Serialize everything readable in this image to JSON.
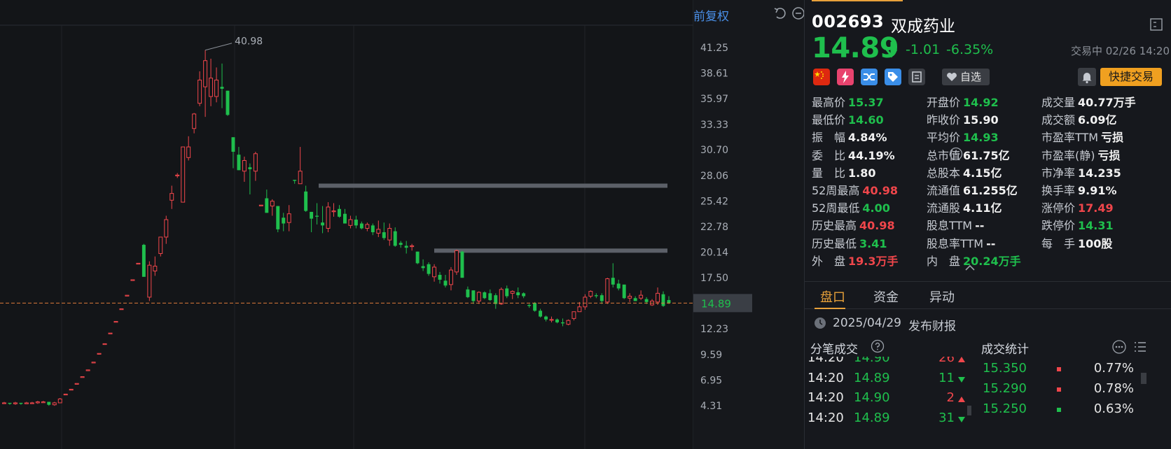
{
  "chart": {
    "adjust_label": "前复权",
    "tools": [
      "undo-icon",
      "zoom-out-icon",
      "zoom-in-icon"
    ],
    "y_ticks": [
      "41.25",
      "38.61",
      "35.97",
      "33.33",
      "30.70",
      "28.06",
      "25.42",
      "22.78",
      "20.14",
      "17.50",
      "14.89",
      "12.23",
      "9.59",
      "6.95",
      "4.31"
    ],
    "peak_label": "40.98",
    "current_price_tag": "14.89",
    "colors": {
      "up": "#f0464b",
      "down": "#1fbf4d",
      "current_line": "#e07b3a",
      "resistance": "#5c6068"
    }
  },
  "chart_data": {
    "type": "candlestick",
    "title": "",
    "y_range": [
      4.31,
      41.25
    ],
    "y_ticks": [
      41.25,
      38.61,
      35.97,
      33.33,
      30.7,
      28.06,
      25.42,
      22.78,
      20.14,
      17.5,
      14.89,
      12.23,
      9.59,
      6.95,
      4.31
    ],
    "peak": 40.98,
    "current": 14.89,
    "resistance_levels": [
      27.0,
      20.3
    ],
    "candles": [
      [
        4.6,
        4.7,
        4.5,
        4.6
      ],
      [
        4.6,
        4.6,
        4.4,
        4.5
      ],
      [
        4.5,
        4.7,
        4.4,
        4.6
      ],
      [
        4.6,
        4.6,
        4.4,
        4.5
      ],
      [
        4.5,
        4.7,
        4.5,
        4.6
      ],
      [
        4.6,
        4.7,
        4.5,
        4.6
      ],
      [
        4.6,
        4.8,
        4.5,
        4.7
      ],
      [
        4.7,
        4.8,
        4.6,
        4.7
      ],
      [
        4.7,
        4.7,
        4.3,
        4.4
      ],
      [
        4.4,
        4.7,
        4.3,
        4.6
      ],
      [
        4.6,
        5.1,
        4.6,
        5.0
      ],
      [
        5.5,
        5.5,
        5.5,
        5.5
      ],
      [
        6.0,
        6.0,
        6.0,
        6.0
      ],
      [
        6.6,
        6.6,
        6.6,
        6.6
      ],
      [
        7.3,
        7.3,
        7.3,
        7.3
      ],
      [
        8.0,
        8.0,
        8.0,
        8.0
      ],
      [
        8.8,
        8.8,
        8.8,
        8.8
      ],
      [
        9.7,
        9.7,
        9.7,
        9.7
      ],
      [
        10.7,
        10.7,
        10.7,
        10.7
      ],
      [
        11.8,
        11.8,
        11.8,
        11.8
      ],
      [
        13.0,
        13.0,
        13.0,
        13.0
      ],
      [
        14.3,
        14.3,
        14.3,
        14.3
      ],
      [
        15.7,
        15.7,
        15.7,
        15.7
      ],
      [
        17.3,
        17.3,
        17.3,
        17.3
      ],
      [
        19.0,
        19.0,
        19.0,
        19.0
      ],
      [
        20.9,
        21.0,
        17.6,
        17.6
      ],
      [
        15.5,
        19.2,
        15.1,
        18.8
      ],
      [
        18.2,
        19.7,
        17.7,
        18.7
      ],
      [
        20.0,
        21.7,
        19.7,
        21.7
      ],
      [
        21.7,
        23.9,
        21.0,
        23.5
      ],
      [
        25.5,
        27.0,
        24.6,
        26.2
      ],
      [
        28.1,
        28.3,
        27.8,
        28.1
      ],
      [
        25.3,
        31.0,
        25.3,
        31.0
      ],
      [
        29.9,
        32.1,
        29.6,
        31.0
      ],
      [
        32.9,
        34.5,
        32.4,
        34.4
      ],
      [
        35.5,
        38.8,
        35.2,
        37.9
      ],
      [
        37.2,
        40.98,
        34.1,
        39.9
      ],
      [
        36.2,
        40.1,
        35.2,
        38.1
      ],
      [
        36.2,
        39.2,
        35.6,
        37.9
      ],
      [
        37.2,
        39.6,
        35.0,
        37.0
      ],
      [
        36.8,
        36.8,
        34.2,
        34.3
      ],
      [
        32.0,
        32.0,
        28.8,
        30.5
      ],
      [
        30.2,
        31.0,
        28.6,
        28.6
      ],
      [
        28.5,
        30.0,
        27.4,
        29.6
      ],
      [
        28.9,
        29.3,
        26.1,
        28.7
      ],
      [
        28.5,
        30.5,
        27.5,
        30.3
      ],
      [
        25.0,
        25.0,
        25.0,
        25.0
      ],
      [
        25.7,
        26.6,
        24.2,
        24.2
      ],
      [
        24.9,
        25.6,
        23.9,
        25.4
      ],
      [
        24.9,
        24.9,
        22.2,
        22.5
      ],
      [
        23.7,
        24.2,
        22.3,
        23.1
      ],
      [
        23.2,
        25.0,
        22.3,
        24.1
      ],
      [
        27.6,
        27.6,
        27.2,
        27.5
      ],
      [
        27.2,
        31.0,
        27.2,
        28.5
      ],
      [
        26.4,
        27.0,
        24.3,
        24.4
      ],
      [
        24.3,
        24.3,
        22.2,
        23.6
      ],
      [
        23.9,
        25.2,
        23.0,
        23.8
      ],
      [
        23.2,
        24.9,
        22.1,
        22.9
      ],
      [
        22.6,
        25.3,
        22.2,
        24.8
      ],
      [
        24.4,
        25.2,
        23.8,
        24.4
      ],
      [
        24.6,
        25.0,
        23.7,
        23.8
      ],
      [
        24.1,
        24.6,
        23.1,
        23.1
      ],
      [
        22.9,
        23.9,
        22.6,
        23.5
      ],
      [
        23.5,
        23.9,
        22.6,
        22.9
      ],
      [
        23.1,
        23.3,
        22.5,
        22.6
      ],
      [
        22.6,
        23.2,
        22.3,
        23.0
      ],
      [
        22.9,
        23.1,
        21.9,
        22.2
      ],
      [
        22.1,
        23.4,
        21.7,
        22.5
      ],
      [
        22.2,
        23.2,
        21.4,
        21.6
      ],
      [
        21.4,
        23.1,
        20.8,
        22.6
      ],
      [
        22.3,
        22.7,
        20.7,
        20.8
      ],
      [
        21.1,
        21.3,
        20.6,
        20.9
      ],
      [
        20.8,
        21.3,
        20.0,
        20.6
      ],
      [
        20.8,
        21.0,
        20.3,
        20.8
      ],
      [
        20.2,
        20.2,
        18.9,
        19.0
      ],
      [
        18.7,
        19.4,
        18.2,
        18.5
      ],
      [
        18.9,
        19.1,
        17.7,
        17.9
      ],
      [
        17.6,
        18.9,
        17.1,
        18.6
      ],
      [
        17.8,
        18.1,
        16.9,
        17.3
      ],
      [
        17.2,
        17.8,
        16.5,
        16.7
      ],
      [
        16.8,
        18.6,
        16.2,
        18.3
      ],
      [
        18.1,
        20.4,
        17.8,
        20.3
      ],
      [
        20.2,
        20.3,
        17.5,
        17.5
      ],
      [
        16.3,
        16.6,
        15.4,
        15.5
      ],
      [
        16.2,
        16.2,
        14.8,
        15.1
      ],
      [
        15.1,
        16.1,
        14.8,
        16.0
      ],
      [
        16.0,
        16.1,
        15.3,
        15.4
      ],
      [
        15.9,
        16.3,
        15.1,
        15.2
      ],
      [
        15.7,
        15.9,
        14.3,
        14.8
      ],
      [
        14.8,
        16.5,
        14.7,
        16.3
      ],
      [
        16.4,
        16.7,
        15.4,
        15.6
      ],
      [
        15.9,
        16.2,
        15.3,
        16.1
      ],
      [
        16.0,
        16.5,
        15.4,
        15.7
      ],
      [
        15.9,
        16.0,
        15.4,
        15.6
      ],
      [
        14.7,
        14.8,
        14.4,
        14.6
      ],
      [
        14.9,
        15.0,
        14.0,
        14.1
      ],
      [
        14.1,
        14.3,
        13.4,
        13.5
      ],
      [
        13.5,
        13.6,
        13.0,
        13.2
      ],
      [
        13.2,
        13.5,
        12.9,
        13.2
      ],
      [
        13.2,
        13.3,
        12.8,
        12.9
      ],
      [
        12.9,
        13.3,
        12.5,
        12.8
      ],
      [
        12.7,
        13.2,
        12.6,
        13.1
      ],
      [
        13.3,
        14.0,
        13.1,
        14.0
      ],
      [
        14.0,
        15.0,
        14.0,
        14.5
      ],
      [
        14.5,
        15.8,
        14.2,
        15.5
      ],
      [
        15.6,
        16.2,
        15.4,
        16.1
      ],
      [
        15.7,
        15.9,
        15.4,
        15.6
      ],
      [
        15.7,
        15.9,
        14.8,
        15.1
      ],
      [
        15.0,
        17.5,
        14.8,
        17.4
      ],
      [
        17.5,
        19.0,
        16.5,
        16.8
      ],
      [
        16.9,
        17.3,
        16.2,
        16.4
      ],
      [
        16.8,
        16.8,
        15.3,
        15.4
      ],
      [
        15.4,
        15.9,
        15.0,
        15.6
      ],
      [
        15.4,
        15.6,
        15.1,
        15.1
      ],
      [
        15.4,
        16.2,
        15.2,
        15.7
      ],
      [
        15.3,
        15.5,
        14.8,
        15.0
      ],
      [
        14.7,
        15.3,
        14.6,
        15.1
      ],
      [
        15.0,
        16.5,
        14.7,
        15.9
      ],
      [
        15.8,
        16.1,
        14.5,
        14.6
      ],
      [
        15.2,
        15.6,
        14.8,
        14.9
      ]
    ]
  },
  "quote": {
    "code": "002693",
    "name": "双成药业",
    "price": "14.89",
    "change": "-1.01",
    "change_pct": "-6.35%",
    "status": "交易中 02/26 14:20",
    "watch_label": "自选",
    "quick_trade_label": "快捷交易",
    "badges": [
      "china-flag-icon",
      "lightning-icon",
      "shuffle-icon",
      "tag-icon",
      "note-icon"
    ]
  },
  "stats": {
    "col1": [
      {
        "label": "最高价",
        "value": "15.37",
        "color": "green"
      },
      {
        "label": "最低价",
        "value": "14.60",
        "color": "green"
      },
      {
        "label": "振　幅",
        "value": "4.84%",
        "color": "white"
      },
      {
        "label": "委　比",
        "value": "44.19%",
        "color": "white"
      },
      {
        "label": "量　比",
        "value": "1.80",
        "color": "white"
      },
      {
        "label": "52周最高",
        "value": "40.98",
        "color": "red"
      },
      {
        "label": "52周最低",
        "value": "4.00",
        "color": "green"
      },
      {
        "label": "历史最高",
        "value": "40.98",
        "color": "red"
      },
      {
        "label": "历史最低",
        "value": "3.41",
        "color": "green"
      },
      {
        "label": "外　盘",
        "value": "19.3万手",
        "color": "red"
      }
    ],
    "col2": [
      {
        "label": "开盘价",
        "value": "14.92",
        "color": "green"
      },
      {
        "label": "昨收价",
        "value": "15.90",
        "color": "white"
      },
      {
        "label": "平均价",
        "value": "14.93",
        "color": "green"
      },
      {
        "label": "总市值",
        "value": "61.75亿",
        "color": "white"
      },
      {
        "label": "总股本",
        "value": "4.15亿",
        "color": "white"
      },
      {
        "label": "流通值",
        "value": "61.255亿",
        "color": "white"
      },
      {
        "label": "流通股",
        "value": "4.11亿",
        "color": "white"
      },
      {
        "label": "股息TTM",
        "value": "--",
        "color": "white"
      },
      {
        "label": "股息率TTM",
        "value": "--",
        "color": "white"
      },
      {
        "label": "内　盘",
        "value": "20.24万手",
        "color": "green"
      }
    ],
    "col3": [
      {
        "label": "成交量",
        "value": "40.77万手",
        "color": "white"
      },
      {
        "label": "成交额",
        "value": "6.09亿",
        "color": "white"
      },
      {
        "label": "市盈率TTM",
        "value": "亏损",
        "color": "white"
      },
      {
        "label": "市盈率(静)",
        "value": "亏损",
        "color": "white"
      },
      {
        "label": "市净率",
        "value": "14.235",
        "color": "white"
      },
      {
        "label": "换手率",
        "value": "9.91%",
        "color": "white"
      },
      {
        "label": "涨停价",
        "value": "17.49",
        "color": "red"
      },
      {
        "label": "跌停价",
        "value": "14.31",
        "color": "green"
      },
      {
        "label": "每　手",
        "value": "100股",
        "color": "white"
      }
    ]
  },
  "tabs": [
    "盘口",
    "资金",
    "异动"
  ],
  "report": {
    "date": "2025/04/29",
    "text": "发布财报"
  },
  "ticks_section": {
    "title": "分笔成交",
    "rows": [
      {
        "time": "14:20",
        "price": "14.90",
        "vol": "26",
        "dir": "up"
      },
      {
        "time": "14:20",
        "price": "14.89",
        "vol": "11",
        "dir": "down"
      },
      {
        "time": "14:20",
        "price": "14.90",
        "vol": "2",
        "dir": "up"
      },
      {
        "time": "14:20",
        "price": "14.89",
        "vol": "31",
        "dir": "down"
      }
    ]
  },
  "volume_stats": {
    "title": "成交统计",
    "rows": [
      {
        "price": "15.350",
        "pct": "0.77%"
      },
      {
        "price": "15.290",
        "pct": "0.78%"
      },
      {
        "price": "15.250",
        "pct": "0.63%"
      }
    ]
  }
}
